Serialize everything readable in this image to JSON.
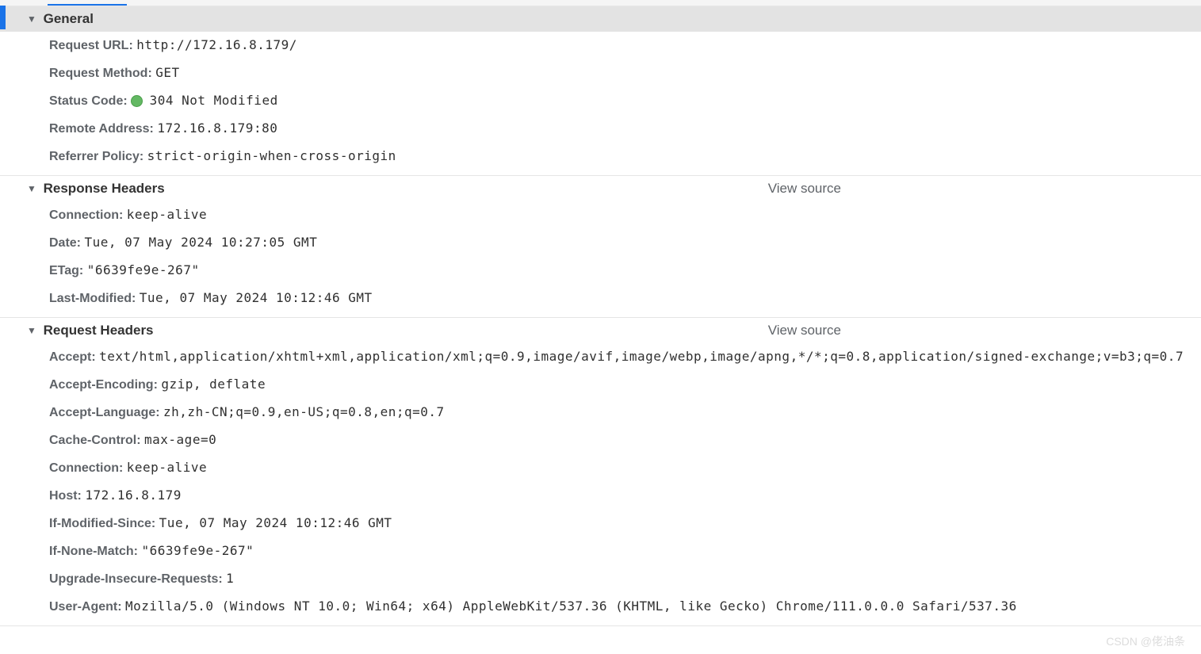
{
  "sections": {
    "general": {
      "title": "General",
      "rows": {
        "request_url": {
          "label": "Request URL:",
          "value": "http://172.16.8.179/"
        },
        "request_method": {
          "label": "Request Method:",
          "value": "GET"
        },
        "status_code": {
          "label": "Status Code:",
          "value": "304 Not Modified"
        },
        "remote_address": {
          "label": "Remote Address:",
          "value": "172.16.8.179:80"
        },
        "referrer_policy": {
          "label": "Referrer Policy:",
          "value": "strict-origin-when-cross-origin"
        }
      }
    },
    "response_headers": {
      "title": "Response Headers",
      "view_source": "View source",
      "rows": {
        "connection": {
          "label": "Connection:",
          "value": "keep-alive"
        },
        "date": {
          "label": "Date:",
          "value": "Tue, 07 May 2024 10:27:05 GMT"
        },
        "etag": {
          "label": "ETag:",
          "value": "\"6639fe9e-267\""
        },
        "last_modified": {
          "label": "Last-Modified:",
          "value": "Tue, 07 May 2024 10:12:46 GMT"
        }
      }
    },
    "request_headers": {
      "title": "Request Headers",
      "view_source": "View source",
      "rows": {
        "accept": {
          "label": "Accept:",
          "value": "text/html,application/xhtml+xml,application/xml;q=0.9,image/avif,image/webp,image/apng,*/*;q=0.8,application/signed-exchange;v=b3;q=0.7"
        },
        "accept_encoding": {
          "label": "Accept-Encoding:",
          "value": "gzip, deflate"
        },
        "accept_language": {
          "label": "Accept-Language:",
          "value": "zh,zh-CN;q=0.9,en-US;q=0.8,en;q=0.7"
        },
        "cache_control": {
          "label": "Cache-Control:",
          "value": "max-age=0"
        },
        "connection": {
          "label": "Connection:",
          "value": "keep-alive"
        },
        "host": {
          "label": "Host:",
          "value": "172.16.8.179"
        },
        "if_modified_since": {
          "label": "If-Modified-Since:",
          "value": "Tue, 07 May 2024 10:12:46 GMT"
        },
        "if_none_match": {
          "label": "If-None-Match:",
          "value": "\"6639fe9e-267\""
        },
        "upgrade_insecure": {
          "label": "Upgrade-Insecure-Requests:",
          "value": "1"
        },
        "user_agent": {
          "label": "User-Agent:",
          "value": "Mozilla/5.0 (Windows NT 10.0; Win64; x64) AppleWebKit/537.36 (KHTML, like Gecko) Chrome/111.0.0.0 Safari/537.36"
        }
      }
    }
  },
  "watermark": "CSDN @佬油条"
}
